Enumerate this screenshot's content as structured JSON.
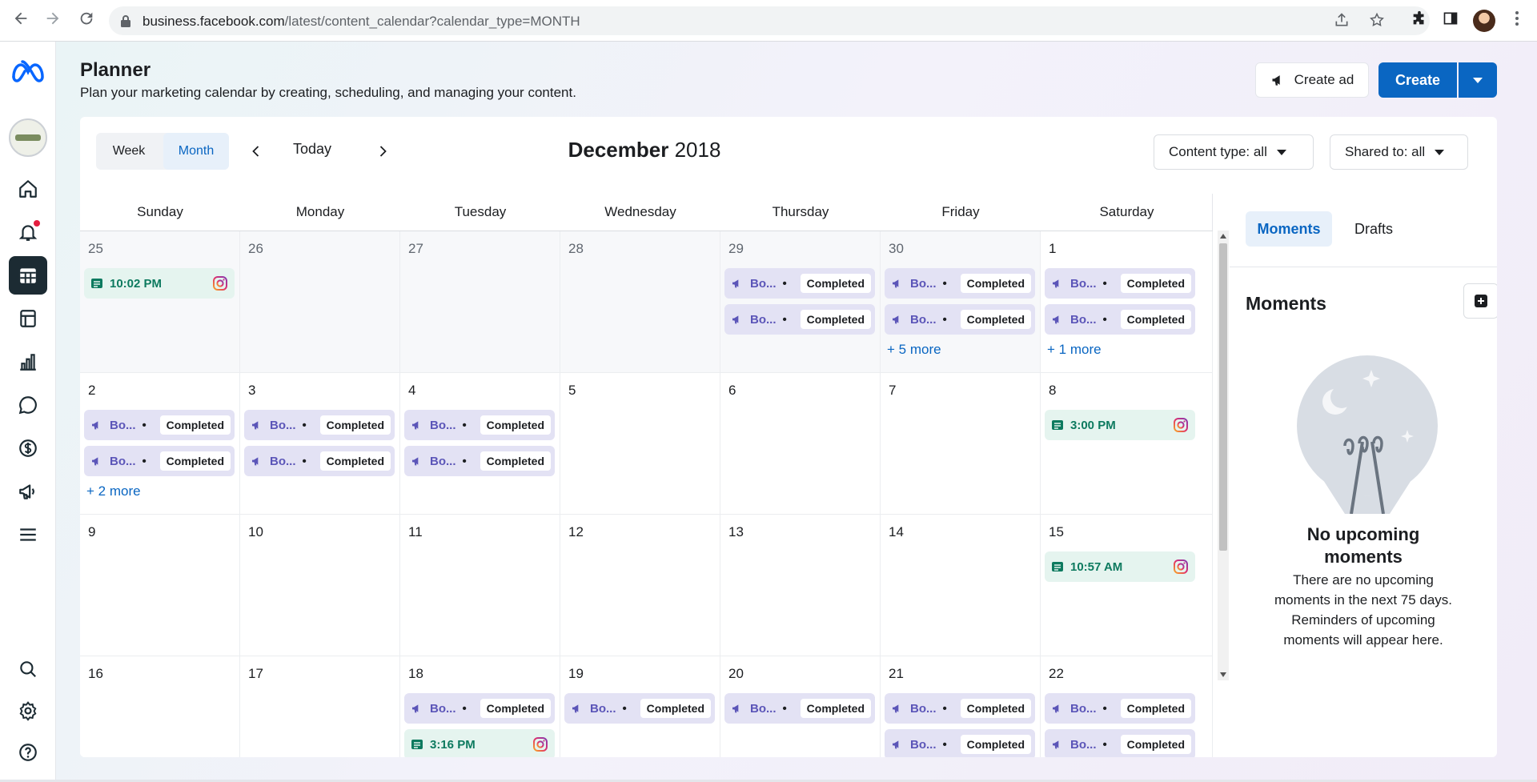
{
  "browser": {
    "url_host": "business.facebook.com",
    "url_path": "/latest/content_calendar?calendar_type=MONTH"
  },
  "header": {
    "title": "Planner",
    "subtitle": "Plan your marketing calendar by creating, scheduling, and managing your content.",
    "create_ad_label": "Create ad",
    "create_label": "Create"
  },
  "toolbar": {
    "week_label": "Week",
    "month_label": "Month",
    "today_label": "Today",
    "month_name": "December",
    "year": "2018",
    "content_type_label": "Content type: all",
    "shared_to_label": "Shared to: all"
  },
  "days_of_week": [
    "Sunday",
    "Monday",
    "Tuesday",
    "Wednesday",
    "Thursday",
    "Friday",
    "Saturday"
  ],
  "calendar": {
    "weeks": [
      [
        {
          "day": "25",
          "current": false,
          "items": [
            {
              "type": "post",
              "label": "10:02 PM",
              "platform": "instagram"
            }
          ]
        },
        {
          "day": "26",
          "current": false,
          "items": []
        },
        {
          "day": "27",
          "current": false,
          "items": []
        },
        {
          "day": "28",
          "current": false,
          "items": []
        },
        {
          "day": "29",
          "current": false,
          "items": [
            {
              "type": "ad",
              "label": "Bo...",
              "status": "Completed"
            },
            {
              "type": "ad",
              "label": "Bo...",
              "status": "Completed"
            }
          ]
        },
        {
          "day": "30",
          "current": false,
          "items": [
            {
              "type": "ad",
              "label": "Bo...",
              "status": "Completed"
            },
            {
              "type": "ad",
              "label": "Bo...",
              "status": "Completed"
            }
          ],
          "more": "+ 5 more"
        },
        {
          "day": "1",
          "current": true,
          "items": [
            {
              "type": "ad",
              "label": "Bo...",
              "status": "Completed"
            },
            {
              "type": "ad",
              "label": "Bo...",
              "status": "Completed"
            }
          ],
          "more": "+ 1 more"
        }
      ],
      [
        {
          "day": "2",
          "current": true,
          "items": [
            {
              "type": "ad",
              "label": "Bo...",
              "status": "Completed"
            },
            {
              "type": "ad",
              "label": "Bo...",
              "status": "Completed"
            }
          ],
          "more": "+ 2 more"
        },
        {
          "day": "3",
          "current": true,
          "items": [
            {
              "type": "ad",
              "label": "Bo...",
              "status": "Completed"
            },
            {
              "type": "ad",
              "label": "Bo...",
              "status": "Completed"
            }
          ]
        },
        {
          "day": "4",
          "current": true,
          "items": [
            {
              "type": "ad",
              "label": "Bo...",
              "status": "Completed"
            },
            {
              "type": "ad",
              "label": "Bo...",
              "status": "Completed"
            }
          ]
        },
        {
          "day": "5",
          "current": true,
          "items": []
        },
        {
          "day": "6",
          "current": true,
          "items": []
        },
        {
          "day": "7",
          "current": true,
          "items": []
        },
        {
          "day": "8",
          "current": true,
          "items": [
            {
              "type": "post",
              "label": "3:00 PM",
              "platform": "instagram"
            }
          ]
        }
      ],
      [
        {
          "day": "9",
          "current": true,
          "items": []
        },
        {
          "day": "10",
          "current": true,
          "items": []
        },
        {
          "day": "11",
          "current": true,
          "items": []
        },
        {
          "day": "12",
          "current": true,
          "items": []
        },
        {
          "day": "13",
          "current": true,
          "items": []
        },
        {
          "day": "14",
          "current": true,
          "items": []
        },
        {
          "day": "15",
          "current": true,
          "items": [
            {
              "type": "post",
              "label": "10:57 AM",
              "platform": "instagram"
            }
          ]
        }
      ],
      [
        {
          "day": "16",
          "current": true,
          "items": []
        },
        {
          "day": "17",
          "current": true,
          "items": []
        },
        {
          "day": "18",
          "current": true,
          "items": [
            {
              "type": "ad",
              "label": "Bo...",
              "status": "Completed"
            },
            {
              "type": "post",
              "label": "3:16 PM",
              "platform": "instagram"
            }
          ]
        },
        {
          "day": "19",
          "current": true,
          "items": [
            {
              "type": "ad",
              "label": "Bo...",
              "status": "Completed"
            }
          ]
        },
        {
          "day": "20",
          "current": true,
          "items": [
            {
              "type": "ad",
              "label": "Bo...",
              "status": "Completed"
            }
          ]
        },
        {
          "day": "21",
          "current": true,
          "items": [
            {
              "type": "ad",
              "label": "Bo...",
              "status": "Completed"
            },
            {
              "type": "ad",
              "label": "Bo...",
              "status": "Completed"
            }
          ]
        },
        {
          "day": "22",
          "current": true,
          "items": [
            {
              "type": "ad",
              "label": "Bo...",
              "status": "Completed"
            },
            {
              "type": "ad",
              "label": "Bo...",
              "status": "Completed"
            }
          ]
        }
      ]
    ]
  },
  "sidebar_panel": {
    "tab_moments": "Moments",
    "tab_drafts": "Drafts",
    "title": "Moments",
    "empty_heading": "No upcoming moments",
    "empty_text": "There are no upcoming moments in the next 75 days. Reminders of upcoming moments will appear here."
  },
  "colors": {
    "accent": "#0a66c2",
    "ad_pill": "#e3e2f4",
    "post_pill": "#e5f4ef",
    "nav_active": "#1c2b33"
  },
  "left_nav_icons": [
    "meta-logo",
    "page-avatar",
    "home-icon",
    "notifications-icon",
    "planner-icon",
    "content-icon",
    "insights-icon",
    "inbox-icon",
    "monetization-icon",
    "ads-icon",
    "all-tools-icon",
    "search-icon",
    "settings-icon",
    "help-icon"
  ]
}
